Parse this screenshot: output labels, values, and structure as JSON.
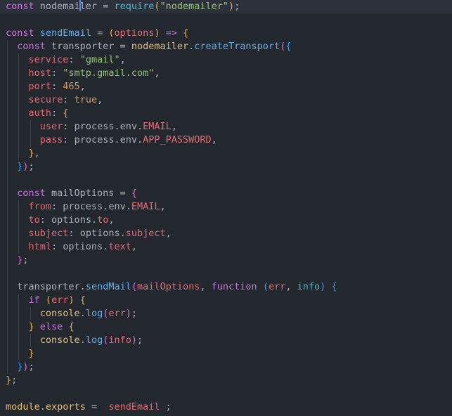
{
  "editor": {
    "language": "javascript",
    "colors": {
      "background": "#23272e",
      "current_line_background": "#2d313c",
      "cursor": "#528bff",
      "indent_guide": "#383e4a",
      "token_colors": {
        "fg": "#abb2bf",
        "kw": "#c678dd",
        "fn": "#61afef",
        "str": "#98c379",
        "prop": "#e06c75",
        "num": "#d19a66",
        "sup": "#e5c07b",
        "cyan": "#56b6c2",
        "b1": "#e0b050",
        "b2": "#da70d6",
        "b3": "#2b9df8"
      }
    },
    "cursor_line": 1,
    "lines": [
      {
        "n": 1,
        "highlight": true,
        "guides": 0,
        "tokens": [
          [
            "kw",
            "const"
          ],
          [
            "fg",
            " nodemai"
          ],
          [
            "cursor",
            ""
          ],
          [
            "fg",
            "ler"
          ],
          [
            "fg",
            " = "
          ],
          [
            "cyan",
            "require"
          ],
          [
            "b1",
            "("
          ],
          [
            "str",
            "\"nodemailer\""
          ],
          [
            "b1",
            ")"
          ],
          [
            "fg",
            ";"
          ]
        ]
      },
      {
        "n": 2,
        "highlight": false,
        "guides": 0,
        "tokens": []
      },
      {
        "n": 3,
        "highlight": false,
        "guides": 0,
        "tokens": [
          [
            "kw",
            "const"
          ],
          [
            "fg",
            " "
          ],
          [
            "fn",
            "sendEmail"
          ],
          [
            "fg",
            " = "
          ],
          [
            "b1",
            "("
          ],
          [
            "prop",
            "options"
          ],
          [
            "b1",
            ")"
          ],
          [
            "fg",
            " "
          ],
          [
            "kw",
            "=>"
          ],
          [
            "fg",
            " "
          ],
          [
            "b1",
            "{"
          ]
        ]
      },
      {
        "n": 4,
        "highlight": false,
        "guides": 1,
        "tokens": [
          [
            "fg",
            "  "
          ],
          [
            "kw",
            "const"
          ],
          [
            "fg",
            " transporter = "
          ],
          [
            "sup",
            "nodemailer"
          ],
          [
            "fg",
            "."
          ],
          [
            "fn",
            "createTransport"
          ],
          [
            "b2",
            "("
          ],
          [
            "b3",
            "{"
          ]
        ]
      },
      {
        "n": 5,
        "highlight": false,
        "guides": 2,
        "tokens": [
          [
            "fg",
            "    "
          ],
          [
            "prop",
            "service"
          ],
          [
            "fg",
            ": "
          ],
          [
            "str",
            "\"gmail\""
          ],
          [
            "fg",
            ","
          ]
        ]
      },
      {
        "n": 6,
        "highlight": false,
        "guides": 2,
        "tokens": [
          [
            "fg",
            "    "
          ],
          [
            "prop",
            "host"
          ],
          [
            "fg",
            ": "
          ],
          [
            "str",
            "\"smtp.gmail.com\""
          ],
          [
            "fg",
            ","
          ]
        ]
      },
      {
        "n": 7,
        "highlight": false,
        "guides": 2,
        "tokens": [
          [
            "fg",
            "    "
          ],
          [
            "prop",
            "port"
          ],
          [
            "fg",
            ": "
          ],
          [
            "num",
            "465"
          ],
          [
            "fg",
            ","
          ]
        ]
      },
      {
        "n": 8,
        "highlight": false,
        "guides": 2,
        "tokens": [
          [
            "fg",
            "    "
          ],
          [
            "prop",
            "secure"
          ],
          [
            "fg",
            ": "
          ],
          [
            "num",
            "true"
          ],
          [
            "fg",
            ","
          ]
        ]
      },
      {
        "n": 9,
        "highlight": false,
        "guides": 2,
        "tokens": [
          [
            "fg",
            "    "
          ],
          [
            "prop",
            "auth"
          ],
          [
            "fg",
            ": "
          ],
          [
            "b1",
            "{"
          ]
        ]
      },
      {
        "n": 10,
        "highlight": false,
        "guides": 3,
        "tokens": [
          [
            "fg",
            "      "
          ],
          [
            "prop",
            "user"
          ],
          [
            "fg",
            ": "
          ],
          [
            "fg",
            "process"
          ],
          [
            "fg",
            "."
          ],
          [
            "fg",
            "env"
          ],
          [
            "fg",
            "."
          ],
          [
            "prop",
            "EMAIL"
          ],
          [
            "fg",
            ","
          ]
        ]
      },
      {
        "n": 11,
        "highlight": false,
        "guides": 3,
        "tokens": [
          [
            "fg",
            "      "
          ],
          [
            "prop",
            "pass"
          ],
          [
            "fg",
            ": "
          ],
          [
            "fg",
            "process"
          ],
          [
            "fg",
            "."
          ],
          [
            "fg",
            "env"
          ],
          [
            "fg",
            "."
          ],
          [
            "prop",
            "APP_PASSWORD"
          ],
          [
            "fg",
            ","
          ]
        ]
      },
      {
        "n": 12,
        "highlight": false,
        "guides": 2,
        "tokens": [
          [
            "fg",
            "    "
          ],
          [
            "b1",
            "}"
          ],
          [
            "fg",
            ","
          ]
        ]
      },
      {
        "n": 13,
        "highlight": false,
        "guides": 1,
        "tokens": [
          [
            "fg",
            "  "
          ],
          [
            "b3",
            "}"
          ],
          [
            "b2",
            ")"
          ],
          [
            "fg",
            ";"
          ]
        ]
      },
      {
        "n": 14,
        "highlight": false,
        "guides": 1,
        "tokens": []
      },
      {
        "n": 15,
        "highlight": false,
        "guides": 1,
        "tokens": [
          [
            "fg",
            "  "
          ],
          [
            "kw",
            "const"
          ],
          [
            "fg",
            " mailOptions = "
          ],
          [
            "b2",
            "{"
          ]
        ]
      },
      {
        "n": 16,
        "highlight": false,
        "guides": 2,
        "tokens": [
          [
            "fg",
            "    "
          ],
          [
            "prop",
            "from"
          ],
          [
            "fg",
            ": "
          ],
          [
            "fg",
            "process"
          ],
          [
            "fg",
            "."
          ],
          [
            "fg",
            "env"
          ],
          [
            "fg",
            "."
          ],
          [
            "prop",
            "EMAIL"
          ],
          [
            "fg",
            ","
          ]
        ]
      },
      {
        "n": 17,
        "highlight": false,
        "guides": 2,
        "tokens": [
          [
            "fg",
            "    "
          ],
          [
            "prop",
            "to"
          ],
          [
            "fg",
            ": "
          ],
          [
            "fg",
            "options"
          ],
          [
            "fg",
            "."
          ],
          [
            "prop",
            "to"
          ],
          [
            "fg",
            ","
          ]
        ]
      },
      {
        "n": 18,
        "highlight": false,
        "guides": 2,
        "tokens": [
          [
            "fg",
            "    "
          ],
          [
            "prop",
            "subject"
          ],
          [
            "fg",
            ": "
          ],
          [
            "fg",
            "options"
          ],
          [
            "fg",
            "."
          ],
          [
            "prop",
            "subject"
          ],
          [
            "fg",
            ","
          ]
        ]
      },
      {
        "n": 19,
        "highlight": false,
        "guides": 2,
        "tokens": [
          [
            "fg",
            "    "
          ],
          [
            "prop",
            "html"
          ],
          [
            "fg",
            ": "
          ],
          [
            "fg",
            "options"
          ],
          [
            "fg",
            "."
          ],
          [
            "prop",
            "text"
          ],
          [
            "fg",
            ","
          ]
        ]
      },
      {
        "n": 20,
        "highlight": false,
        "guides": 1,
        "tokens": [
          [
            "fg",
            "  "
          ],
          [
            "b2",
            "}"
          ],
          [
            "fg",
            ";"
          ]
        ]
      },
      {
        "n": 21,
        "highlight": false,
        "guides": 1,
        "tokens": []
      },
      {
        "n": 22,
        "highlight": false,
        "guides": 1,
        "tokens": [
          [
            "fg",
            "  transporter"
          ],
          [
            "fg",
            "."
          ],
          [
            "fn",
            "sendMail"
          ],
          [
            "b2",
            "("
          ],
          [
            "prop",
            "mailOptions"
          ],
          [
            "fg",
            ", "
          ],
          [
            "kw",
            "function"
          ],
          [
            "fg",
            " "
          ],
          [
            "b3",
            "("
          ],
          [
            "prop",
            "err"
          ],
          [
            "fg",
            ", "
          ],
          [
            "cyan",
            "info"
          ],
          [
            "b3",
            ")"
          ],
          [
            "fg",
            " "
          ],
          [
            "b3",
            "{"
          ]
        ]
      },
      {
        "n": 23,
        "highlight": false,
        "guides": 2,
        "tokens": [
          [
            "fg",
            "    "
          ],
          [
            "kw",
            "if"
          ],
          [
            "fg",
            " "
          ],
          [
            "b1",
            "("
          ],
          [
            "prop",
            "err"
          ],
          [
            "b1",
            ")"
          ],
          [
            "fg",
            " "
          ],
          [
            "b1",
            "{"
          ]
        ]
      },
      {
        "n": 24,
        "highlight": false,
        "guides": 3,
        "tokens": [
          [
            "fg",
            "      "
          ],
          [
            "sup",
            "console"
          ],
          [
            "fg",
            "."
          ],
          [
            "fn",
            "log"
          ],
          [
            "b2",
            "("
          ],
          [
            "prop",
            "err"
          ],
          [
            "b2",
            ")"
          ],
          [
            "fg",
            ";"
          ]
        ]
      },
      {
        "n": 25,
        "highlight": false,
        "guides": 2,
        "tokens": [
          [
            "fg",
            "    "
          ],
          [
            "b1",
            "}"
          ],
          [
            "fg",
            " "
          ],
          [
            "kw",
            "else"
          ],
          [
            "fg",
            " "
          ],
          [
            "b1",
            "{"
          ]
        ]
      },
      {
        "n": 26,
        "highlight": false,
        "guides": 3,
        "tokens": [
          [
            "fg",
            "      "
          ],
          [
            "sup",
            "console"
          ],
          [
            "fg",
            "."
          ],
          [
            "fn",
            "log"
          ],
          [
            "b2",
            "("
          ],
          [
            "prop",
            "info"
          ],
          [
            "b2",
            ")"
          ],
          [
            "fg",
            ";"
          ]
        ]
      },
      {
        "n": 27,
        "highlight": false,
        "guides": 2,
        "tokens": [
          [
            "fg",
            "    "
          ],
          [
            "b1",
            "}"
          ]
        ]
      },
      {
        "n": 28,
        "highlight": false,
        "guides": 1,
        "tokens": [
          [
            "fg",
            "  "
          ],
          [
            "b3",
            "}"
          ],
          [
            "b2",
            ")"
          ],
          [
            "fg",
            ";"
          ]
        ]
      },
      {
        "n": 29,
        "highlight": false,
        "guides": 0,
        "tokens": [
          [
            "b1",
            "}"
          ],
          [
            "fg",
            ";"
          ]
        ]
      },
      {
        "n": 30,
        "highlight": false,
        "guides": 0,
        "tokens": []
      },
      {
        "n": 31,
        "highlight": false,
        "guides": 0,
        "tokens": [
          [
            "sup",
            "module"
          ],
          [
            "fg",
            "."
          ],
          [
            "sup",
            "exports"
          ],
          [
            "fg",
            " =  "
          ],
          [
            "prop",
            "sendEmail"
          ],
          [
            "fg",
            " ;"
          ]
        ]
      }
    ]
  }
}
